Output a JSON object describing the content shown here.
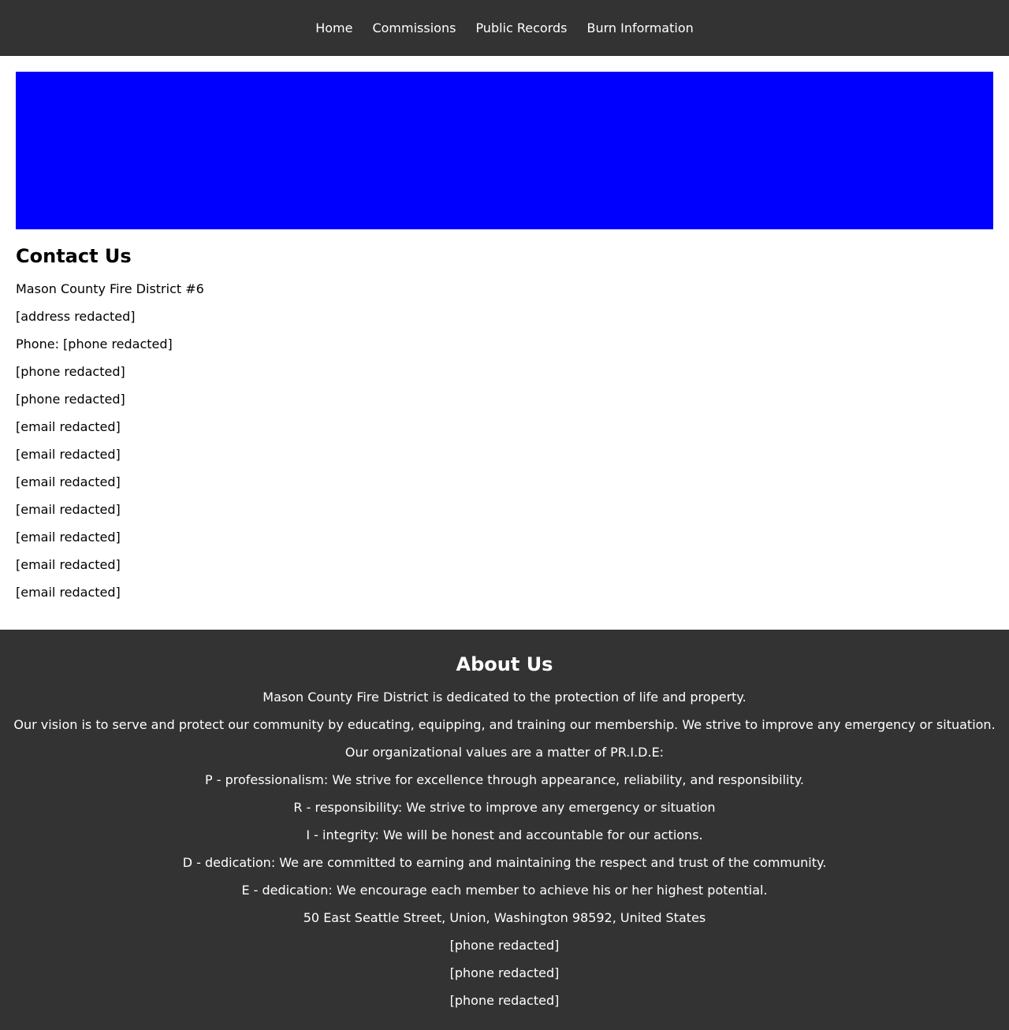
{
  "nav": {
    "items": [
      {
        "label": "Home"
      },
      {
        "label": "Commissions"
      },
      {
        "label": "Public Records"
      },
      {
        "label": "Burn Information"
      }
    ]
  },
  "banner": {
    "color": "#0000ff"
  },
  "contact": {
    "title": "Contact Us",
    "lines": [
      "Mason County Fire District #6",
      "[address redacted]",
      "Phone: [phone redacted]",
      "[phone redacted]",
      "[phone redacted]",
      "[email redacted]",
      "[email redacted]",
      "[email redacted]",
      "[email redacted]",
      "[email redacted]",
      "[email redacted]",
      "[email redacted]"
    ]
  },
  "about": {
    "title": "About Us",
    "lines": [
      "Mason County Fire District is dedicated to the protection of life and property.",
      "Our vision is to serve and protect our community by educating, equipping, and training our membership. We strive to improve any emergency or situation.",
      "Our organizational values are a matter of PR.I.D.E:",
      "P - professionalism: We strive for excellence through appearance, reliability, and responsibility.",
      "R - responsibility: We strive to improve any emergency or situation",
      "I - integrity: We will be honest and accountable for our actions.",
      "D - dedication: We are committed to earning and maintaining the respect and trust of the community.",
      "E - dedication: We encourage each member to achieve his or her highest potential.",
      "50 East Seattle Street, Union, Washington 98592, United States",
      "[phone redacted]",
      "[phone redacted]",
      "[phone redacted]"
    ]
  }
}
